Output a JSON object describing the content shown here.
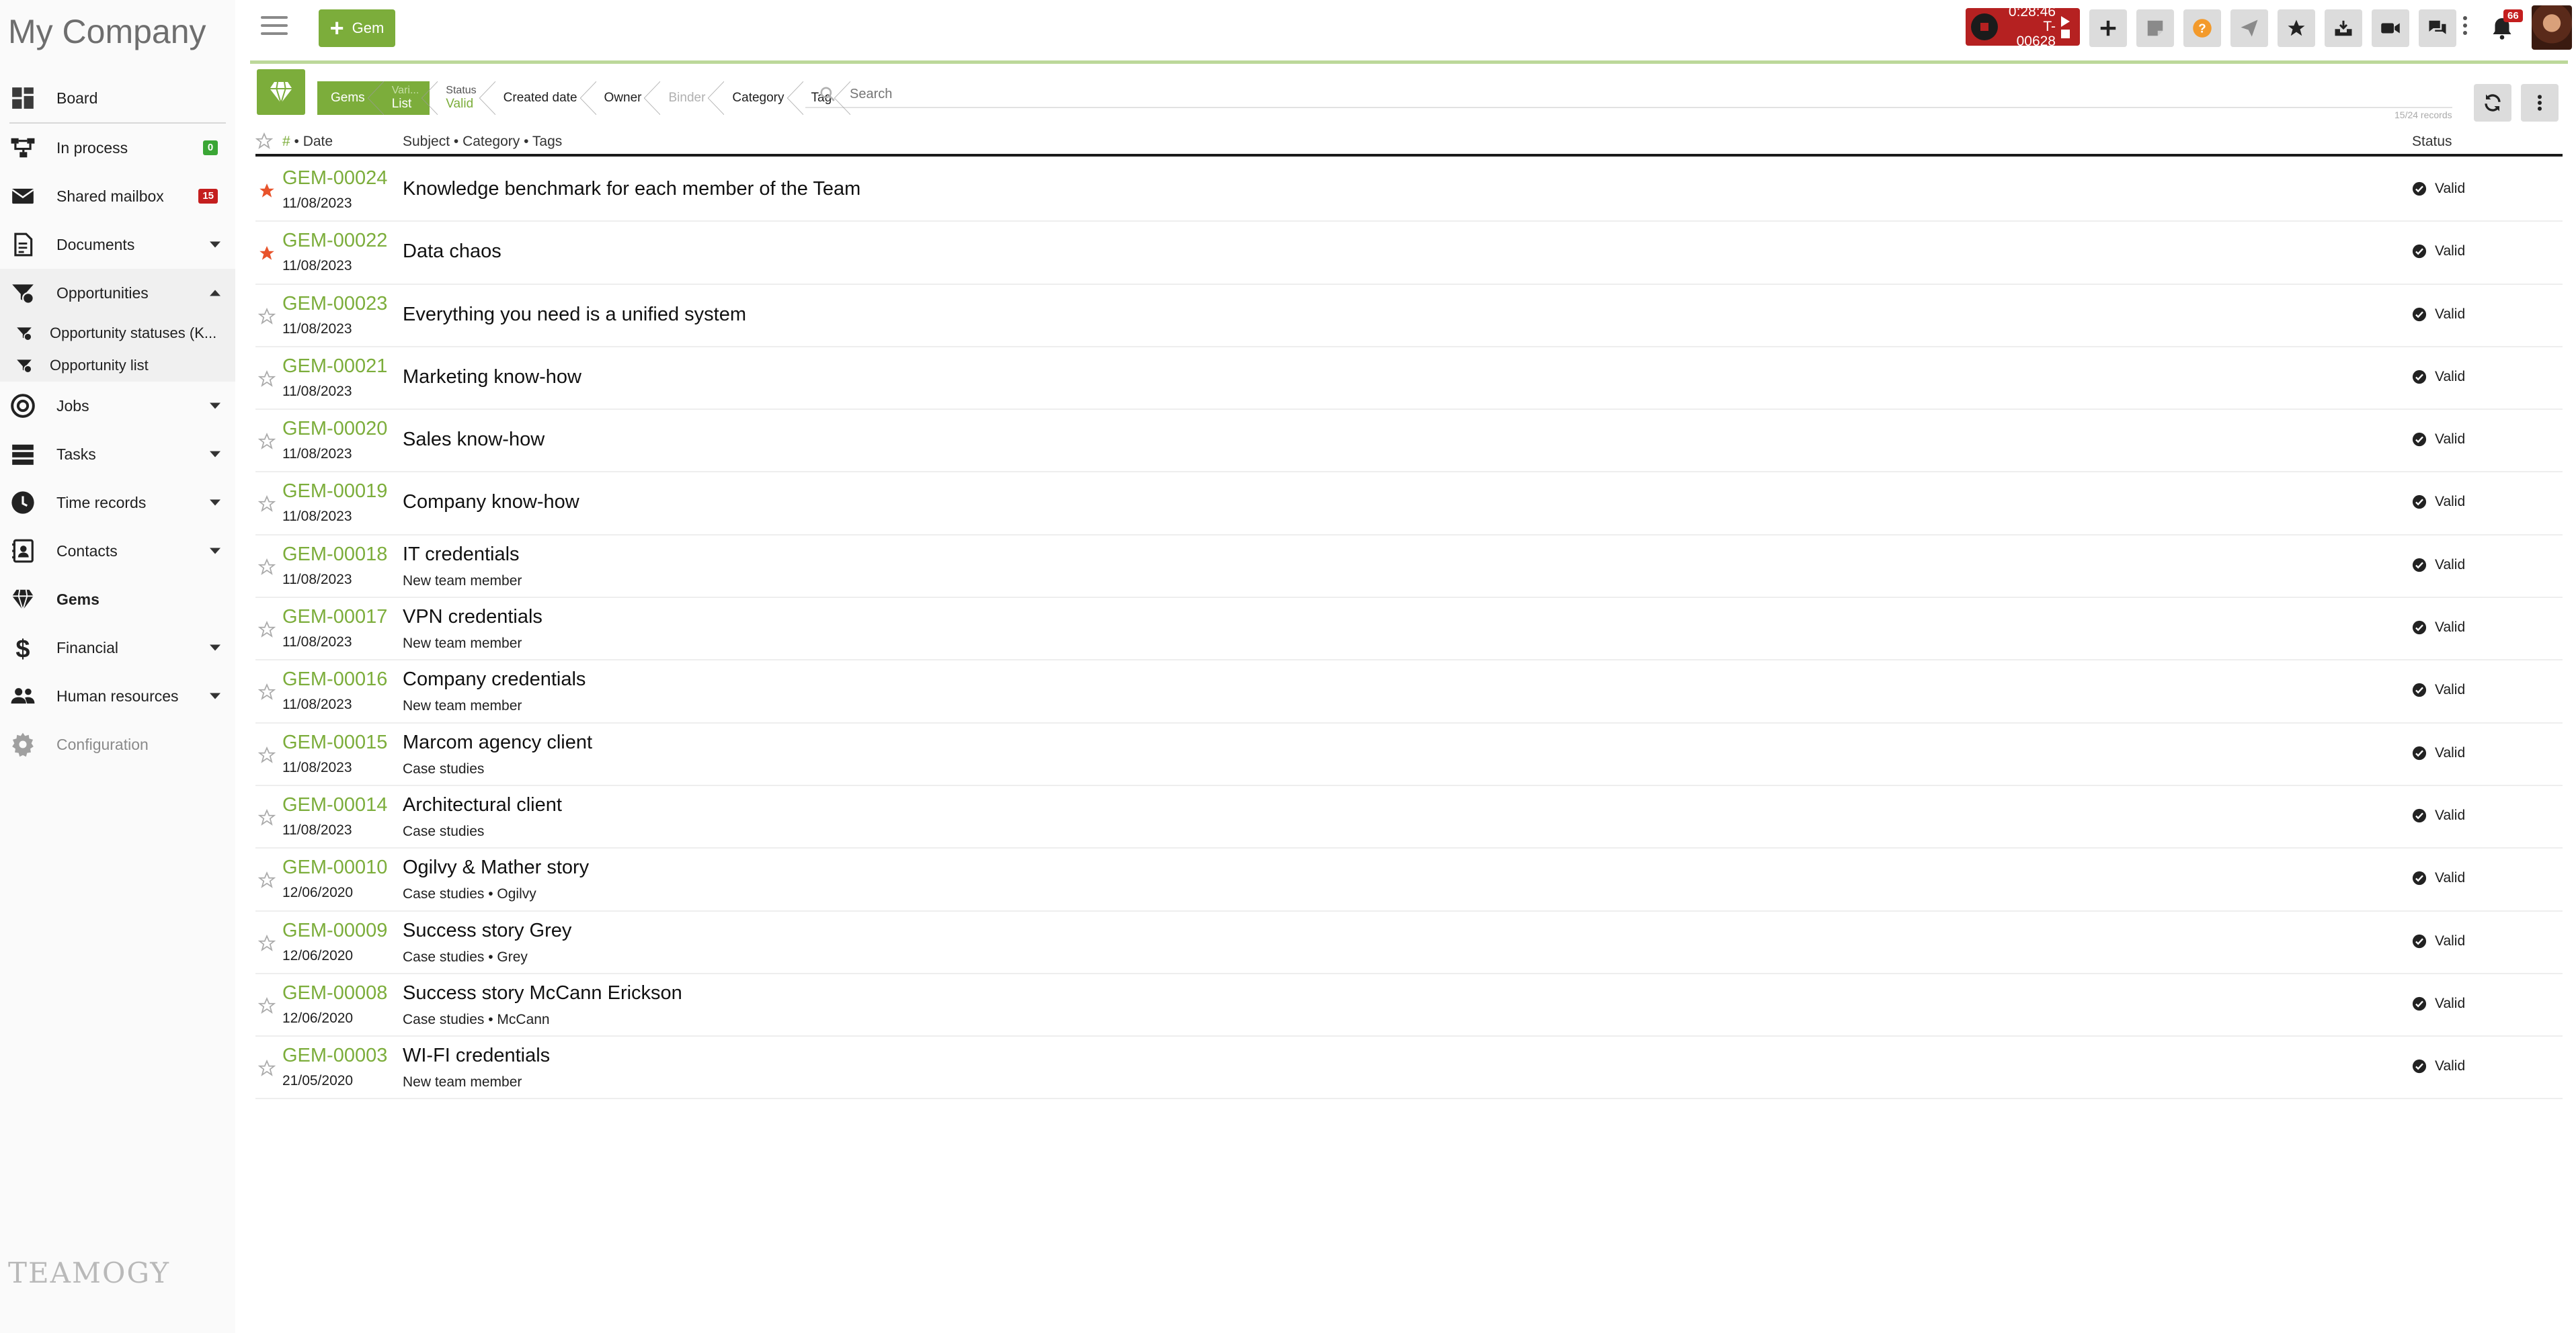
{
  "app": {
    "company": "My Company",
    "add_button_label": "Gem"
  },
  "sidebar": {
    "items": [
      {
        "key": "board",
        "label": "Board",
        "icon": "board-icon"
      },
      {
        "key": "in-process",
        "label": "In process",
        "badge": "0",
        "badge_color": "#3aa635",
        "icon": "process-icon"
      },
      {
        "key": "shared-mailbox",
        "label": "Shared mailbox",
        "badge": "15",
        "badge_color": "#c41e1e",
        "icon": "mail-icon"
      },
      {
        "key": "documents",
        "label": "Documents",
        "icon": "document-icon"
      },
      {
        "key": "opportunities",
        "label": "Opportunities",
        "icon": "opportunity-icon"
      },
      {
        "key": "jobs",
        "label": "Jobs",
        "icon": "target-icon"
      },
      {
        "key": "tasks",
        "label": "Tasks",
        "icon": "tasks-icon"
      },
      {
        "key": "time-records",
        "label": "Time records",
        "icon": "clock-icon"
      },
      {
        "key": "contacts",
        "label": "Contacts",
        "icon": "contacts-icon"
      },
      {
        "key": "gems",
        "label": "Gems",
        "icon": "gem-icon"
      },
      {
        "key": "financial",
        "label": "Financial",
        "icon": "dollar-icon"
      },
      {
        "key": "human-resources",
        "label": "Human resources",
        "icon": "people-icon"
      },
      {
        "key": "configuration",
        "label": "Configuration",
        "icon": "gear-icon"
      }
    ],
    "opportunity_subitems": [
      {
        "label": "Opportunity statuses (K..."
      },
      {
        "label": "Opportunity list"
      }
    ],
    "footer_logo": "TEAMOGY"
  },
  "topbar": {
    "timer_time": "0:28:46",
    "timer_ticket": "T-00628",
    "notification_count": "66",
    "buttons": [
      "plus-icon",
      "note-icon",
      "help-icon",
      "send-icon",
      "star-icon",
      "inbox-icon",
      "video-icon",
      "chat-icon"
    ]
  },
  "toolbar": {
    "crumbs": [
      {
        "top": "",
        "bottom": "Gems"
      },
      {
        "top": "Vari...",
        "bottom": "List"
      },
      {
        "top": "Status",
        "bottom": "Valid"
      },
      {
        "top": "",
        "bottom": "Created date"
      },
      {
        "top": "",
        "bottom": "Owner"
      },
      {
        "top": "",
        "bottom": "Binder"
      },
      {
        "top": "",
        "bottom": "Category"
      },
      {
        "top": "",
        "bottom": "Tag"
      }
    ],
    "search_placeholder": "Search",
    "record_count": "15/24 records"
  },
  "table": {
    "headers": {
      "number": "#",
      "number_rest": " • Date",
      "subject": "Subject • Category • Tags",
      "status": "Status"
    },
    "rows": [
      {
        "id": "GEM-00024",
        "date": "11/08/2023",
        "subject": "Knowledge benchmark for each member of the Team",
        "meta": "",
        "starred": true,
        "status": "Valid"
      },
      {
        "id": "GEM-00022",
        "date": "11/08/2023",
        "subject": "Data chaos",
        "meta": "",
        "starred": true,
        "status": "Valid"
      },
      {
        "id": "GEM-00023",
        "date": "11/08/2023",
        "subject": "Everything you need is a unified system",
        "meta": "",
        "starred": false,
        "status": "Valid"
      },
      {
        "id": "GEM-00021",
        "date": "11/08/2023",
        "subject": "Marketing know-how",
        "meta": "",
        "starred": false,
        "status": "Valid"
      },
      {
        "id": "GEM-00020",
        "date": "11/08/2023",
        "subject": "Sales know-how",
        "meta": "",
        "starred": false,
        "status": "Valid"
      },
      {
        "id": "GEM-00019",
        "date": "11/08/2023",
        "subject": "Company know-how",
        "meta": "",
        "starred": false,
        "status": "Valid"
      },
      {
        "id": "GEM-00018",
        "date": "11/08/2023",
        "subject": "IT credentials",
        "meta": "New team member",
        "starred": false,
        "status": "Valid"
      },
      {
        "id": "GEM-00017",
        "date": "11/08/2023",
        "subject": "VPN credentials",
        "meta": "New team member",
        "starred": false,
        "status": "Valid"
      },
      {
        "id": "GEM-00016",
        "date": "11/08/2023",
        "subject": "Company credentials",
        "meta": "New team member",
        "starred": false,
        "status": "Valid"
      },
      {
        "id": "GEM-00015",
        "date": "11/08/2023",
        "subject": "Marcom agency client",
        "meta": "Case studies",
        "starred": false,
        "status": "Valid"
      },
      {
        "id": "GEM-00014",
        "date": "11/08/2023",
        "subject": "Architectural client",
        "meta": "Case studies",
        "starred": false,
        "status": "Valid"
      },
      {
        "id": "GEM-00010",
        "date": "12/06/2020",
        "subject": "Ogilvy & Mather story",
        "meta": "Case studies • Ogilvy",
        "starred": false,
        "status": "Valid"
      },
      {
        "id": "GEM-00009",
        "date": "12/06/2020",
        "subject": "Success story Grey",
        "meta": "Case studies • Grey",
        "starred": false,
        "status": "Valid"
      },
      {
        "id": "GEM-00008",
        "date": "12/06/2020",
        "subject": "Success story McCann Erickson",
        "meta": "Case studies • McCann",
        "starred": false,
        "status": "Valid"
      },
      {
        "id": "GEM-00003",
        "date": "21/05/2020",
        "subject": "WI-FI credentials",
        "meta": "New team member",
        "starred": false,
        "status": "Valid"
      }
    ]
  },
  "colors": {
    "accent_green": "#7cad3b",
    "star_active": "#e8532b",
    "timer_red": "#b52121"
  }
}
